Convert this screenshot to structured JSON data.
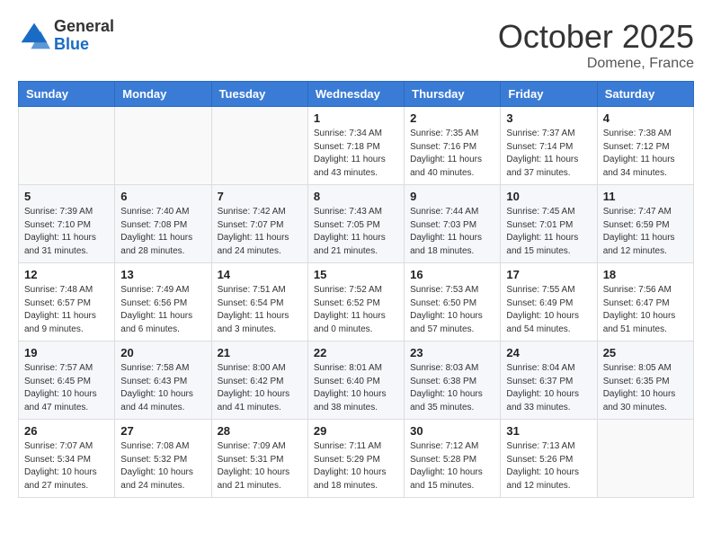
{
  "header": {
    "logo_general": "General",
    "logo_blue": "Blue",
    "month": "October 2025",
    "location": "Domene, France"
  },
  "weekdays": [
    "Sunday",
    "Monday",
    "Tuesday",
    "Wednesday",
    "Thursday",
    "Friday",
    "Saturday"
  ],
  "weeks": [
    [
      {
        "day": "",
        "sunrise": "",
        "sunset": "",
        "daylight": ""
      },
      {
        "day": "",
        "sunrise": "",
        "sunset": "",
        "daylight": ""
      },
      {
        "day": "",
        "sunrise": "",
        "sunset": "",
        "daylight": ""
      },
      {
        "day": "1",
        "sunrise": "Sunrise: 7:34 AM",
        "sunset": "Sunset: 7:18 PM",
        "daylight": "Daylight: 11 hours and 43 minutes."
      },
      {
        "day": "2",
        "sunrise": "Sunrise: 7:35 AM",
        "sunset": "Sunset: 7:16 PM",
        "daylight": "Daylight: 11 hours and 40 minutes."
      },
      {
        "day": "3",
        "sunrise": "Sunrise: 7:37 AM",
        "sunset": "Sunset: 7:14 PM",
        "daylight": "Daylight: 11 hours and 37 minutes."
      },
      {
        "day": "4",
        "sunrise": "Sunrise: 7:38 AM",
        "sunset": "Sunset: 7:12 PM",
        "daylight": "Daylight: 11 hours and 34 minutes."
      }
    ],
    [
      {
        "day": "5",
        "sunrise": "Sunrise: 7:39 AM",
        "sunset": "Sunset: 7:10 PM",
        "daylight": "Daylight: 11 hours and 31 minutes."
      },
      {
        "day": "6",
        "sunrise": "Sunrise: 7:40 AM",
        "sunset": "Sunset: 7:08 PM",
        "daylight": "Daylight: 11 hours and 28 minutes."
      },
      {
        "day": "7",
        "sunrise": "Sunrise: 7:42 AM",
        "sunset": "Sunset: 7:07 PM",
        "daylight": "Daylight: 11 hours and 24 minutes."
      },
      {
        "day": "8",
        "sunrise": "Sunrise: 7:43 AM",
        "sunset": "Sunset: 7:05 PM",
        "daylight": "Daylight: 11 hours and 21 minutes."
      },
      {
        "day": "9",
        "sunrise": "Sunrise: 7:44 AM",
        "sunset": "Sunset: 7:03 PM",
        "daylight": "Daylight: 11 hours and 18 minutes."
      },
      {
        "day": "10",
        "sunrise": "Sunrise: 7:45 AM",
        "sunset": "Sunset: 7:01 PM",
        "daylight": "Daylight: 11 hours and 15 minutes."
      },
      {
        "day": "11",
        "sunrise": "Sunrise: 7:47 AM",
        "sunset": "Sunset: 6:59 PM",
        "daylight": "Daylight: 11 hours and 12 minutes."
      }
    ],
    [
      {
        "day": "12",
        "sunrise": "Sunrise: 7:48 AM",
        "sunset": "Sunset: 6:57 PM",
        "daylight": "Daylight: 11 hours and 9 minutes."
      },
      {
        "day": "13",
        "sunrise": "Sunrise: 7:49 AM",
        "sunset": "Sunset: 6:56 PM",
        "daylight": "Daylight: 11 hours and 6 minutes."
      },
      {
        "day": "14",
        "sunrise": "Sunrise: 7:51 AM",
        "sunset": "Sunset: 6:54 PM",
        "daylight": "Daylight: 11 hours and 3 minutes."
      },
      {
        "day": "15",
        "sunrise": "Sunrise: 7:52 AM",
        "sunset": "Sunset: 6:52 PM",
        "daylight": "Daylight: 11 hours and 0 minutes."
      },
      {
        "day": "16",
        "sunrise": "Sunrise: 7:53 AM",
        "sunset": "Sunset: 6:50 PM",
        "daylight": "Daylight: 10 hours and 57 minutes."
      },
      {
        "day": "17",
        "sunrise": "Sunrise: 7:55 AM",
        "sunset": "Sunset: 6:49 PM",
        "daylight": "Daylight: 10 hours and 54 minutes."
      },
      {
        "day": "18",
        "sunrise": "Sunrise: 7:56 AM",
        "sunset": "Sunset: 6:47 PM",
        "daylight": "Daylight: 10 hours and 51 minutes."
      }
    ],
    [
      {
        "day": "19",
        "sunrise": "Sunrise: 7:57 AM",
        "sunset": "Sunset: 6:45 PM",
        "daylight": "Daylight: 10 hours and 47 minutes."
      },
      {
        "day": "20",
        "sunrise": "Sunrise: 7:58 AM",
        "sunset": "Sunset: 6:43 PM",
        "daylight": "Daylight: 10 hours and 44 minutes."
      },
      {
        "day": "21",
        "sunrise": "Sunrise: 8:00 AM",
        "sunset": "Sunset: 6:42 PM",
        "daylight": "Daylight: 10 hours and 41 minutes."
      },
      {
        "day": "22",
        "sunrise": "Sunrise: 8:01 AM",
        "sunset": "Sunset: 6:40 PM",
        "daylight": "Daylight: 10 hours and 38 minutes."
      },
      {
        "day": "23",
        "sunrise": "Sunrise: 8:03 AM",
        "sunset": "Sunset: 6:38 PM",
        "daylight": "Daylight: 10 hours and 35 minutes."
      },
      {
        "day": "24",
        "sunrise": "Sunrise: 8:04 AM",
        "sunset": "Sunset: 6:37 PM",
        "daylight": "Daylight: 10 hours and 33 minutes."
      },
      {
        "day": "25",
        "sunrise": "Sunrise: 8:05 AM",
        "sunset": "Sunset: 6:35 PM",
        "daylight": "Daylight: 10 hours and 30 minutes."
      }
    ],
    [
      {
        "day": "26",
        "sunrise": "Sunrise: 7:07 AM",
        "sunset": "Sunset: 5:34 PM",
        "daylight": "Daylight: 10 hours and 27 minutes."
      },
      {
        "day": "27",
        "sunrise": "Sunrise: 7:08 AM",
        "sunset": "Sunset: 5:32 PM",
        "daylight": "Daylight: 10 hours and 24 minutes."
      },
      {
        "day": "28",
        "sunrise": "Sunrise: 7:09 AM",
        "sunset": "Sunset: 5:31 PM",
        "daylight": "Daylight: 10 hours and 21 minutes."
      },
      {
        "day": "29",
        "sunrise": "Sunrise: 7:11 AM",
        "sunset": "Sunset: 5:29 PM",
        "daylight": "Daylight: 10 hours and 18 minutes."
      },
      {
        "day": "30",
        "sunrise": "Sunrise: 7:12 AM",
        "sunset": "Sunset: 5:28 PM",
        "daylight": "Daylight: 10 hours and 15 minutes."
      },
      {
        "day": "31",
        "sunrise": "Sunrise: 7:13 AM",
        "sunset": "Sunset: 5:26 PM",
        "daylight": "Daylight: 10 hours and 12 minutes."
      },
      {
        "day": "",
        "sunrise": "",
        "sunset": "",
        "daylight": ""
      }
    ]
  ]
}
